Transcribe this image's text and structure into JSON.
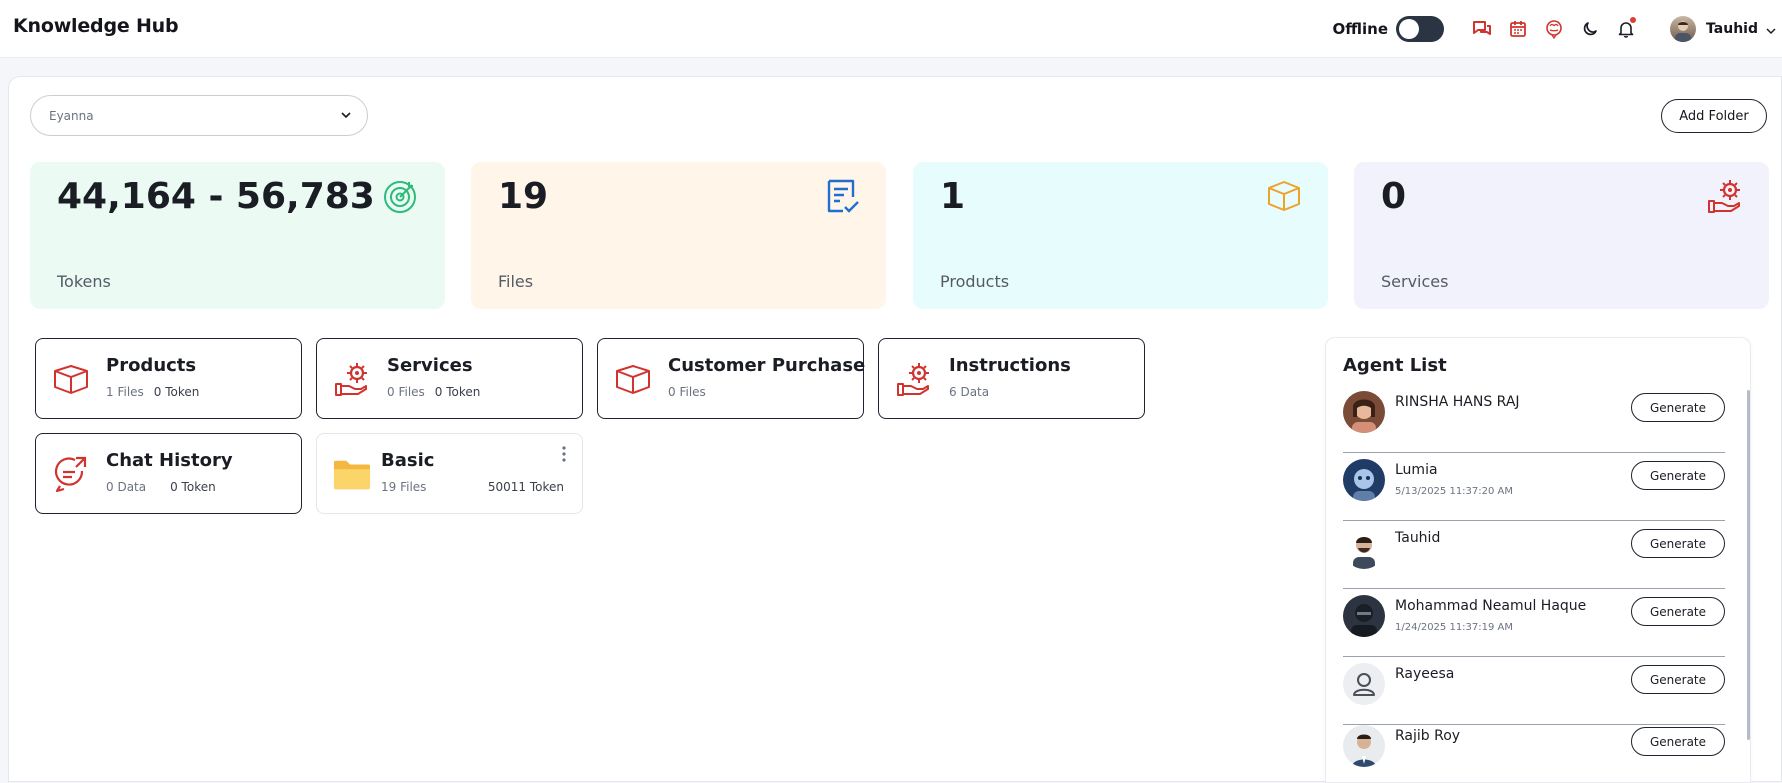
{
  "header": {
    "title": "Knowledge Hub",
    "offline_label": "Offline",
    "user_name": "Tauhid"
  },
  "folder_select": {
    "value": "Eyanna"
  },
  "add_folder_label": "Add Folder",
  "stats": [
    {
      "value": "44,164 - 56,783",
      "label": "Tokens",
      "bg": "#ebfbf4",
      "icon": "target-icon"
    },
    {
      "value": "19",
      "label": "Files",
      "bg": "#fff5e9",
      "icon": "file-check-icon"
    },
    {
      "value": "1",
      "label": "Products",
      "bg": "#e7fcfd",
      "icon": "box-icon"
    },
    {
      "value": "0",
      "label": "Services",
      "bg": "#f2f2fd",
      "icon": "hand-gear-icon"
    }
  ],
  "cards": [
    {
      "title": "Products",
      "meta1": "1 Files",
      "meta2": "0 Token"
    },
    {
      "title": "Services",
      "meta1": "0 Files",
      "meta2": "0 Token"
    },
    {
      "title": "Customer Purchase",
      "meta1": "0 Files"
    },
    {
      "title": "Instructions",
      "meta1": "6 Data"
    },
    {
      "title": "Chat History",
      "meta1": "0 Data",
      "meta2": "0 Token"
    },
    {
      "title": "Basic",
      "meta1": "19 Files",
      "right": "50011 Token"
    }
  ],
  "agent_list": {
    "title": "Agent List",
    "generate_label": "Generate",
    "agents": [
      {
        "name": "RINSHA HANS RAJ",
        "sub": ""
      },
      {
        "name": "Lumia",
        "sub": "5/13/2025 11:37:20 AM"
      },
      {
        "name": "Tauhid",
        "sub": ""
      },
      {
        "name": "Mohammad Neamul Haque",
        "sub": "1/24/2025 11:37:19 AM"
      },
      {
        "name": "Rayeesa",
        "sub": ""
      },
      {
        "name": "Rajib Roy",
        "sub": ""
      }
    ]
  },
  "colors": {
    "accent_red": "#d1342f",
    "green": "#2dbb7a",
    "blue": "#1f6fd1",
    "orange": "#f0a12a"
  }
}
